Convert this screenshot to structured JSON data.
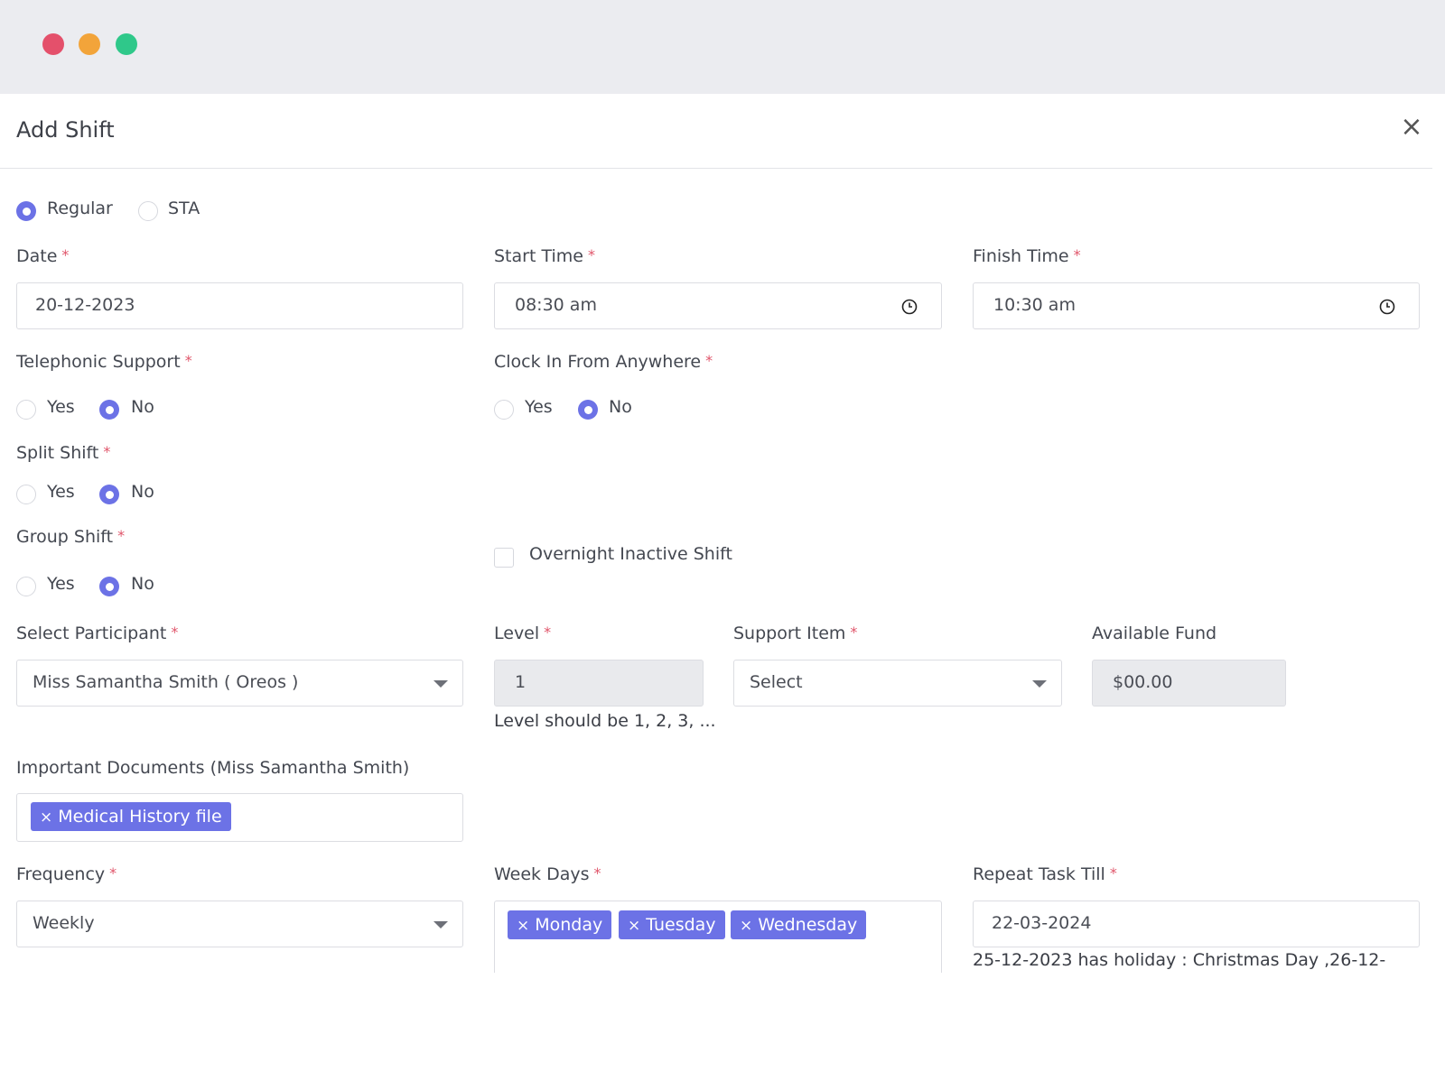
{
  "window": {
    "controls": {
      "close_color": "#e4506b",
      "minimize_color": "#f2a43a",
      "maximize_color": "#2fc88a"
    }
  },
  "modal": {
    "title": "Add Shift",
    "close_symbol": "×"
  },
  "shift_type": {
    "options": [
      "Regular",
      "STA"
    ],
    "selected": "Regular"
  },
  "date": {
    "label": "Date",
    "value": "20-12-2023"
  },
  "start_time": {
    "label": "Start Time",
    "value": "08:30  am"
  },
  "finish_time": {
    "label": "Finish Time",
    "value": "10:30  am"
  },
  "telephonic_support": {
    "label": "Telephonic Support",
    "yes": "Yes",
    "no": "No",
    "selected": "No"
  },
  "clock_in_anywhere": {
    "label": "Clock In From Anywhere",
    "yes": "Yes",
    "no": "No",
    "selected": "No"
  },
  "split_shift": {
    "label": "Split Shift",
    "yes": "Yes",
    "no": "No",
    "selected": "No"
  },
  "group_shift": {
    "label": "Group Shift",
    "yes": "Yes",
    "no": "No",
    "selected": "No"
  },
  "overnight": {
    "label": "Overnight Inactive Shift",
    "checked": false
  },
  "participant": {
    "label": "Select Participant",
    "value": "Miss Samantha Smith ( Oreos )"
  },
  "level": {
    "label": "Level",
    "value": "1",
    "hint": "Level should be 1, 2, 3, ..."
  },
  "support_item": {
    "label": "Support Item",
    "value": "Select"
  },
  "available_fund": {
    "label": "Available Fund",
    "value": "$00.00"
  },
  "documents": {
    "label": "Important Documents (Miss Samantha Smith)",
    "tags": [
      "Medical History file"
    ]
  },
  "frequency": {
    "label": "Frequency",
    "value": "Weekly"
  },
  "week_days": {
    "label": "Week Days",
    "tags": [
      "Monday",
      "Tuesday",
      "Wednesday"
    ]
  },
  "repeat_till": {
    "label": "Repeat Task Till",
    "value": "22-03-2024",
    "note": "25-12-2023 has holiday : Christmas Day ,26-12-"
  },
  "required_marker": "*",
  "tag_remove_symbol": "×",
  "accent_color": "#6c72e6"
}
